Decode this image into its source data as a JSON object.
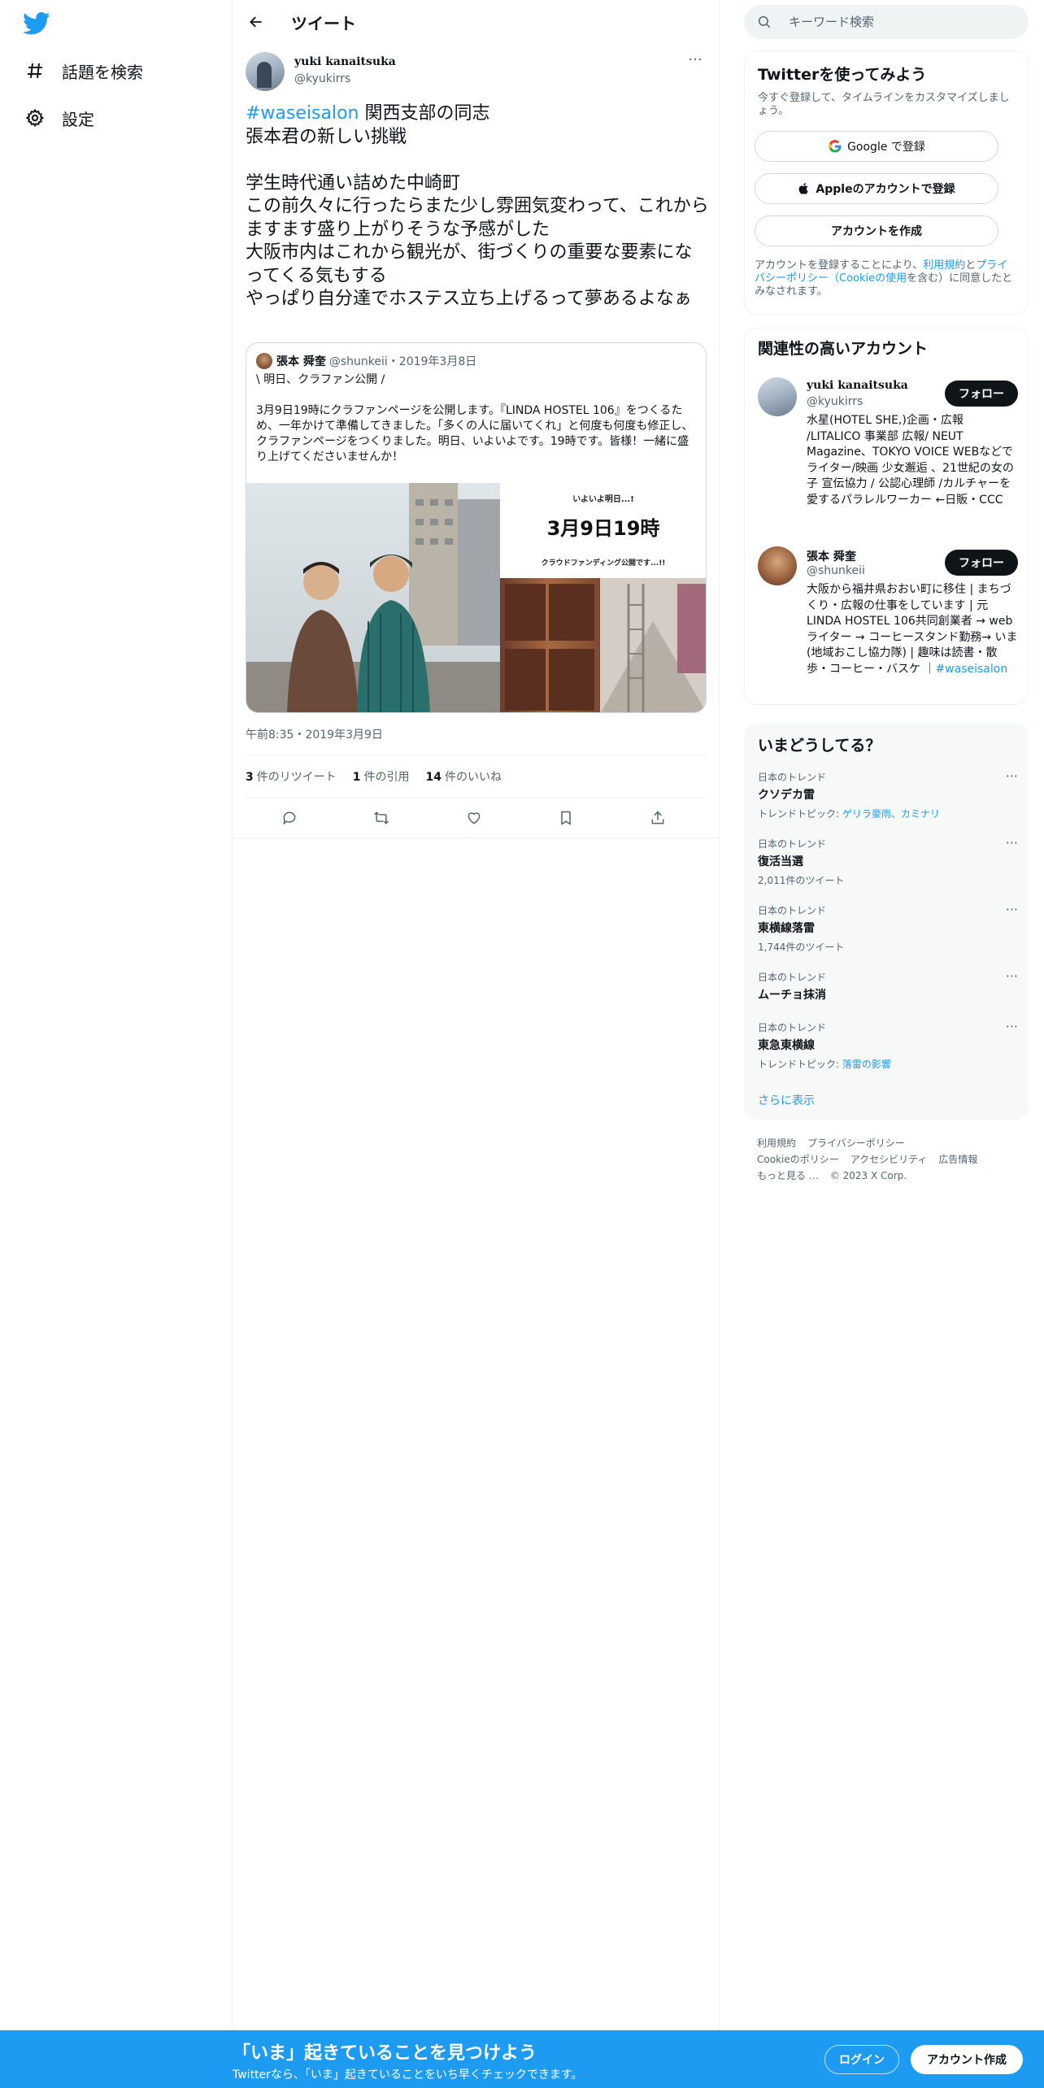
{
  "nav": {
    "items": [
      {
        "label": "話題を検索",
        "icon": "hashtag-icon"
      },
      {
        "label": "設定",
        "icon": "gear-icon"
      }
    ]
  },
  "header": {
    "title": "ツイート"
  },
  "tweet": {
    "author_name": "yuki kanaitsuka",
    "author_handle": "@kyukirrs",
    "hashtag": "#waseisalon",
    "text_after_hashtag": " 関西支部の同志\n張本君の新しい挑戦\n\n学生時代通い詰めた中崎町\nこの前久々に行ったらまた少し雰囲気変わって、これからますます盛り上がりそうな予感がした\n大阪市内はこれから観光が、街づくりの重要な要素になってくる気もする\nやっぱり自分達でホステス立ち上げるって夢あるよなぁ",
    "timestamp": "午前8:35・2019年3月9日",
    "stats": {
      "retweets_count": "3",
      "retweets_label": "件のリツイート",
      "quotes_count": "1",
      "quotes_label": "件の引用",
      "likes_count": "14",
      "likes_label": "件のいいね"
    }
  },
  "quoted": {
    "name": "張本 舜奎",
    "handle_date": "@shunkeii・2019年3月8日",
    "text": "\\ 明日、クラファン公開 /\n\n3月9日19時にクラファンページを公開します。『LINDA HOSTEL 106』をつくるため、一年かけて準備してきました。「多くの人に届いてくれ」と何度も何度も修正し、クラファンページをつくりました。明日、いよいよです。19時です。皆様！一緒に盛り上げてくださいませんか！",
    "media": {
      "line1": "いよいよ明日...!",
      "line2": "3月9日19時",
      "line3": "クラウドファンディング公開です...!!"
    }
  },
  "search": {
    "placeholder": "キーワード検索"
  },
  "signup_card": {
    "title": "Twitterを使ってみよう",
    "desc": "今すぐ登録して、タイムラインをカスタマイズしましょう。",
    "google": "Google で登録",
    "apple": "Appleのアカウントで登録",
    "create": "アカウントを作成",
    "terms_pre": "アカウントを登録することにより、",
    "terms_link1": "利用規約",
    "terms_mid": "と",
    "terms_link2": "プライバシーポリシー（Cookieの使用",
    "terms_post": "を含む）に同意したとみなされます。"
  },
  "related": {
    "title": "関連性の高いアカウント",
    "follow_label": "フォロー",
    "accounts": [
      {
        "name": "yuki kanaitsuka",
        "handle": "@kyukirrs",
        "bio": "水星(HOTEL SHE,)企画・広報 /LITALICO 事業部 広報/ NEUT Magazine、TOKYO VOICE WEBなどでライター/映画 少女邂逅 、21世紀の女の子 宣伝協力 / 公認心理師 /カルチャーを愛するパラレルワーカー ←日販・CCC"
      },
      {
        "name": "張本 舜奎",
        "handle": "@shunkeii",
        "bio": "大阪から福井県おおい町に移住 | まちづくり・広報の仕事をしています | 元LINDA HOSTEL 106共同創業者 → webライター → コーヒースタンド勤務→ いま (地域おこし協力隊) | 趣味は読書・散歩・コーヒー・バスケ ｜",
        "bio_link": "#waseisalon"
      }
    ]
  },
  "trends": {
    "title": "いまどうしてる？",
    "items": [
      {
        "meta": "日本のトレンド",
        "name": "クソデカ雷",
        "sub_label": "トレンドトピック: ",
        "sub_link": "ゲリラ豪雨、カミナリ"
      },
      {
        "meta": "日本のトレンド",
        "name": "復活当選",
        "sub": "2,011件のツイート"
      },
      {
        "meta": "日本のトレンド",
        "name": "東横線落雷",
        "sub": "1,744件のツイート"
      },
      {
        "meta": "日本のトレンド",
        "name": "ムーチョ抹消"
      },
      {
        "meta": "日本のトレンド",
        "name": "東急東横線",
        "sub_label": "トレンドトピック: ",
        "sub_link": "落雷の影響"
      }
    ],
    "show_more": "さらに表示"
  },
  "footer": {
    "links": [
      "利用規約",
      "プライバシーポリシー",
      "Cookieのポリシー",
      "アクセシビリティ",
      "広告情報",
      "もっと見る …"
    ],
    "copyright": "© 2023 X Corp."
  },
  "banner": {
    "title": "「いま」起きていることを見つけよう",
    "subtitle": "Twitterなら、「いま」起きていることをいち早くチェックできます。",
    "login": "ログイン",
    "signup": "アカウント作成"
  },
  "colors": {
    "accent": "#1d9bf0",
    "text": "#0f1419",
    "muted": "#536471",
    "border": "#eff3f4"
  }
}
